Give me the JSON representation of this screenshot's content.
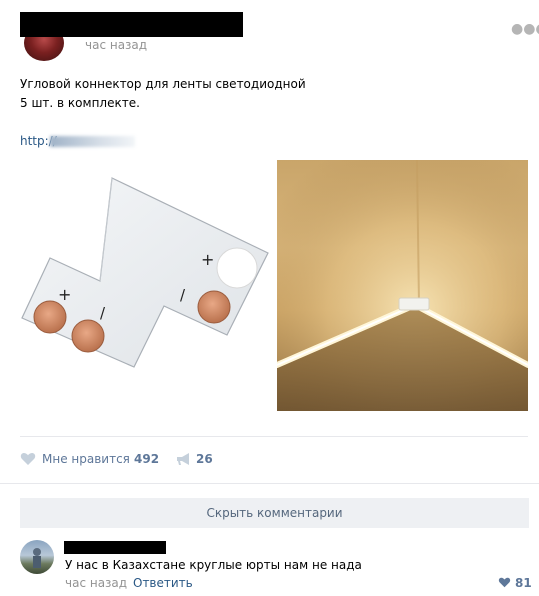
{
  "post": {
    "time": "час назад",
    "menu_icon": "more-dots-icon",
    "text_line1": "Угловой коннектор для ленты светодиодной",
    "text_line2": "5 шт. в комплекте.",
    "link_prefix": "http://"
  },
  "photos": {
    "left": {
      "plus_top": "+",
      "plus_left": "+",
      "minus_right": "/",
      "minus_left": "/"
    }
  },
  "actions": {
    "like_label": "Мне нравится",
    "like_count": "492",
    "share_count": "26"
  },
  "comments": {
    "hide_label": "Скрыть комментарии",
    "items": [
      {
        "text": "У нас в Казахстане круглые юрты нам не нада",
        "time": "час назад",
        "reply_label": "Ответить",
        "like_count": "81"
      }
    ]
  },
  "colors": {
    "link": "#2a5885",
    "muted": "#939393",
    "action": "#5e7799",
    "divider": "#e7e8ec",
    "button_bg": "#eef0f3"
  }
}
